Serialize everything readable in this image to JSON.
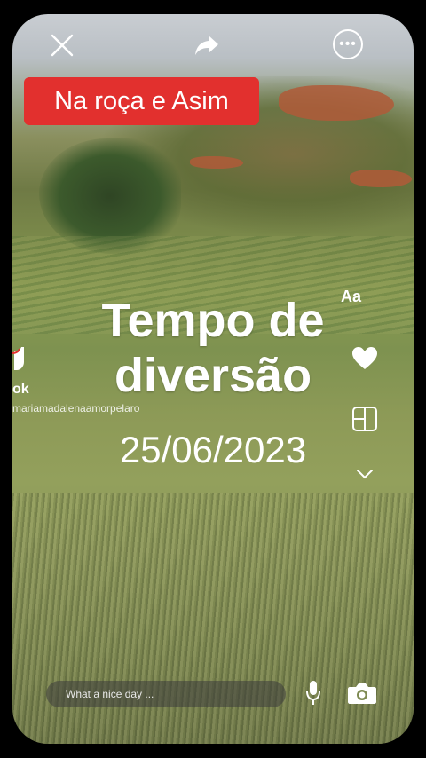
{
  "header": {
    "title_label": "Na roça e Asim",
    "close_icon": "close-icon",
    "share_icon": "share-icon",
    "more_icon": "more-icon"
  },
  "overlay": {
    "main_text": "Tempo de diversão",
    "date_text": "25/06/2023"
  },
  "tools": {
    "text_tool_label": "Aa",
    "heart_icon": "heart-icon",
    "layout_icon": "layout-icon",
    "chevron_icon": "chevron-down-icon"
  },
  "watermark": {
    "brand_label": "ok",
    "username": "mariamadalenaamorpelaro"
  },
  "composer": {
    "placeholder": "What a nice day ...",
    "mic_icon": "mic-icon",
    "camera_icon": "camera-icon"
  },
  "colors": {
    "label_red": "#e2302e",
    "text_white": "#ffffff"
  }
}
